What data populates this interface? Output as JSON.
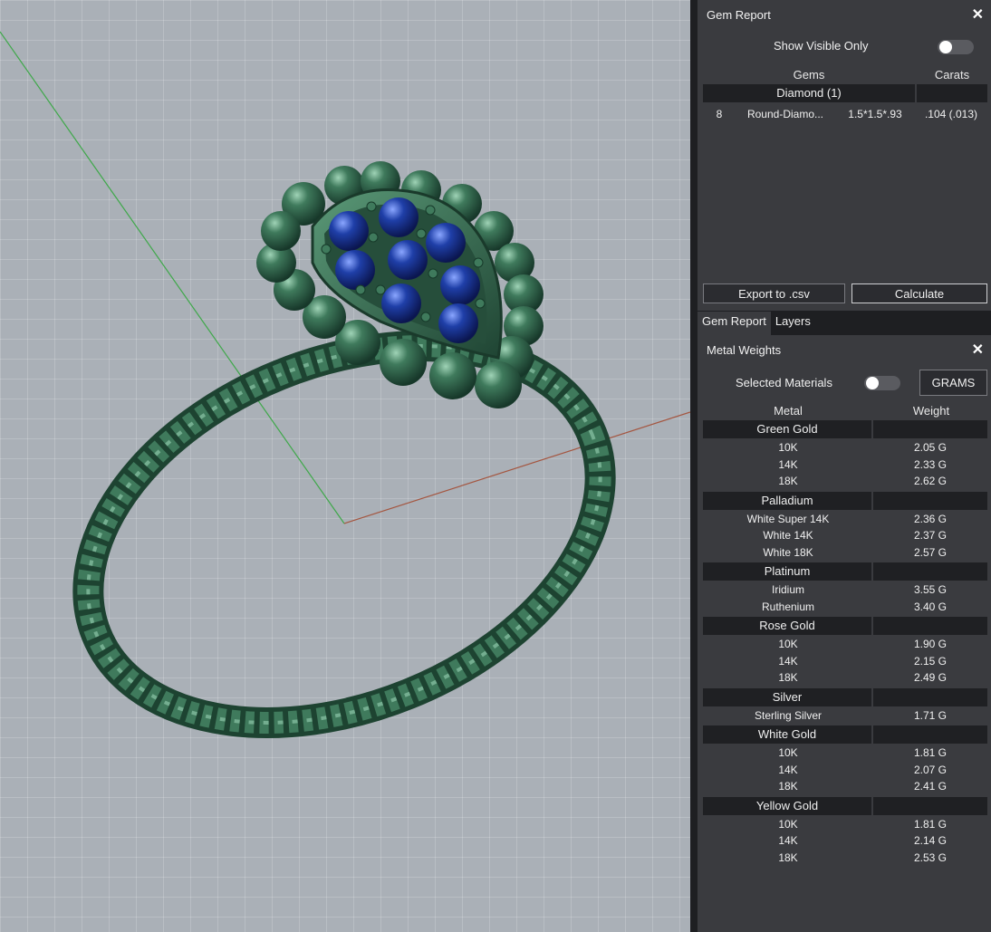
{
  "gem_report": {
    "title": "Gem Report",
    "show_visible_only": "Show Visible Only",
    "col_gems": "Gems",
    "col_carats": "Carats",
    "group": "Diamond (1)",
    "row": {
      "count": "8",
      "shape": "Round-Diamo...",
      "size": "1.5*1.5*.93",
      "carats": ".104 (.013)"
    },
    "export_label": "Export to .csv",
    "calculate_label": "Calculate"
  },
  "tabs": [
    "Gem Report",
    "Layers"
  ],
  "metal_weights": {
    "title": "Metal Weights",
    "selected_materials": "Selected Materials",
    "units_button": "GRAMS",
    "col_metal": "Metal",
    "col_weight": "Weight",
    "groups": [
      {
        "name": "Green Gold",
        "items": [
          {
            "metal": "10K",
            "weight": "2.05 G"
          },
          {
            "metal": "14K",
            "weight": "2.33 G"
          },
          {
            "metal": "18K",
            "weight": "2.62 G"
          }
        ]
      },
      {
        "name": "Palladium",
        "items": [
          {
            "metal": "White Super 14K",
            "weight": "2.36 G"
          },
          {
            "metal": "White 14K",
            "weight": "2.37 G"
          },
          {
            "metal": "White 18K",
            "weight": "2.57 G"
          }
        ]
      },
      {
        "name": "Platinum",
        "items": [
          {
            "metal": "Iridium",
            "weight": "3.55 G"
          },
          {
            "metal": "Ruthenium",
            "weight": "3.40 G"
          }
        ]
      },
      {
        "name": "Rose Gold",
        "items": [
          {
            "metal": "10K",
            "weight": "1.90 G"
          },
          {
            "metal": "14K",
            "weight": "2.15 G"
          },
          {
            "metal": "18K",
            "weight": "2.49 G"
          }
        ]
      },
      {
        "name": "Silver",
        "items": [
          {
            "metal": "Sterling Silver",
            "weight": "1.71 G"
          }
        ]
      },
      {
        "name": "White Gold",
        "items": [
          {
            "metal": "10K",
            "weight": "1.81 G"
          },
          {
            "metal": "14K",
            "weight": "2.07 G"
          },
          {
            "metal": "18K",
            "weight": "2.41 G"
          }
        ]
      },
      {
        "name": "Yellow Gold",
        "items": [
          {
            "metal": "10K",
            "weight": "1.81 G"
          },
          {
            "metal": "14K",
            "weight": "2.14 G"
          },
          {
            "metal": "18K",
            "weight": "2.53 G"
          }
        ]
      }
    ]
  },
  "colors": {
    "ring_metal": "#3f7a5c",
    "gem": "#1f3fa8",
    "panel_bg": "#3a3b3f",
    "dark_bg": "#1e1f22"
  },
  "icons": {
    "close": "close-icon"
  }
}
